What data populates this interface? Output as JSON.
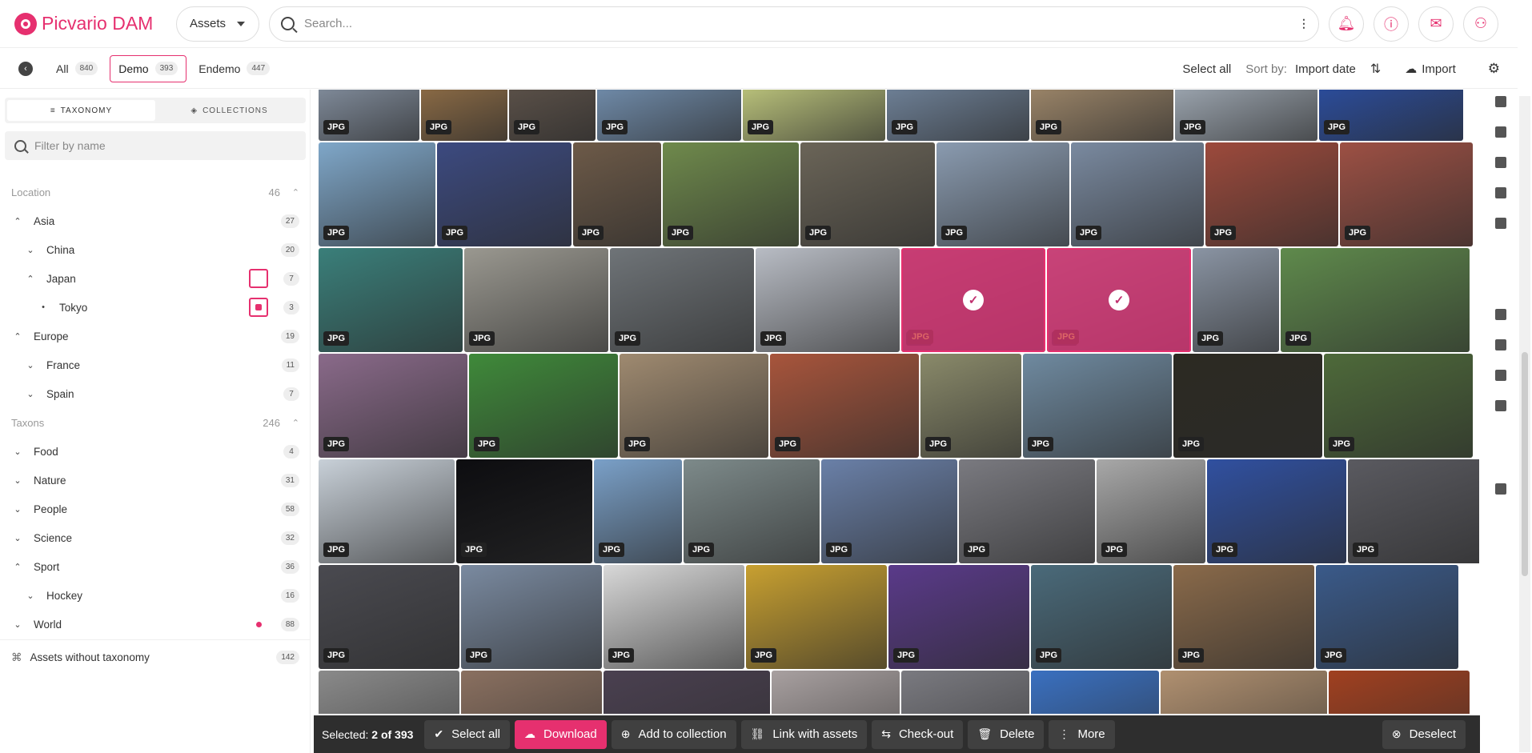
{
  "app": {
    "brand_prefix": "Picvario",
    "brand_suffix": "DAM"
  },
  "header": {
    "scope_dropdown": "Assets",
    "search_placeholder": "Search...",
    "icons": [
      "sliders-icon",
      "bell-icon",
      "info-icon",
      "inbox-icon",
      "user-icon"
    ]
  },
  "subbar": {
    "tabs": [
      {
        "label": "All",
        "count": "840"
      },
      {
        "label": "Demo",
        "count": "393"
      },
      {
        "label": "Endemo",
        "count": "447"
      }
    ],
    "select_all": "Select all",
    "sort_label": "Sort by:",
    "sort_value": "Import date",
    "import": "Import"
  },
  "sidebar": {
    "switch": {
      "taxonomy": "TAXONOMY",
      "collections": "COLLECTIONS"
    },
    "filter_placeholder": "Filter by name",
    "tree": [
      {
        "label": "Location",
        "count": "46",
        "section": true
      },
      {
        "label": "Asia",
        "count": "27",
        "chev": "up",
        "level": 0
      },
      {
        "label": "China",
        "count": "20",
        "chev": "down",
        "level": 1
      },
      {
        "label": "Japan",
        "count": "7",
        "chev": "up",
        "level": 1,
        "checkbox": "empty"
      },
      {
        "label": "Tokyo",
        "count": "3",
        "chev": "bullet",
        "level": 2,
        "checkbox": "partial"
      },
      {
        "label": "Europe",
        "count": "19",
        "chev": "up",
        "level": 0
      },
      {
        "label": "France",
        "count": "11",
        "chev": "down",
        "level": 1
      },
      {
        "label": "Spain",
        "count": "7",
        "chev": "down",
        "level": 1
      },
      {
        "label": "Taxons",
        "count": "246",
        "section": true
      },
      {
        "label": "Food",
        "count": "4",
        "chev": "down",
        "level": 0
      },
      {
        "label": "Nature",
        "count": "31",
        "chev": "down",
        "level": 0
      },
      {
        "label": "People",
        "count": "58",
        "chev": "down",
        "level": 0
      },
      {
        "label": "Science",
        "count": "32",
        "chev": "down",
        "level": 0
      },
      {
        "label": "Sport",
        "count": "36",
        "chev": "up",
        "level": 0
      },
      {
        "label": "Hockey",
        "count": "16",
        "chev": "down",
        "level": 1
      },
      {
        "label": "World",
        "count": "88",
        "chev": "down",
        "level": 0,
        "dot": true
      }
    ],
    "without_taxonomy": {
      "label": "Assets without taxonomy",
      "count": "142"
    }
  },
  "grid": {
    "badge": "JPG",
    "rows": [
      {
        "widths": [
          126,
          108,
          108,
          180,
          178,
          178,
          178,
          178,
          180
        ],
        "colors": [
          "#7f8a99",
          "#8a6a45",
          "#5a5048",
          "#6f8aa8",
          "#b8c07a",
          "#6d7f95",
          "#9a8468",
          "#9aa3ad",
          "#2b4c9a"
        ]
      },
      {
        "widths": [
          146,
          168,
          110,
          170,
          168,
          166,
          166,
          166,
          166
        ],
        "colors": [
          "#7fa7c9",
          "#3c4a80",
          "#6d5a48",
          "#6f8a4c",
          "#6b6558",
          "#8a9bb0",
          "#7a8aa0",
          "#9d4a3c",
          "#9d5044"
        ]
      },
      {
        "widths": [
          180,
          180,
          180,
          180,
          180,
          180,
          108,
          236
        ],
        "colors": [
          "#3a7f7a",
          "#9a9890",
          "#6f7478",
          "#b8bcc4",
          "#c47a90",
          "#c8a2b0",
          "#8a94a3",
          "#5f8a4c"
        ],
        "selected": [
          4,
          5
        ]
      },
      {
        "widths": [
          186,
          186,
          186,
          186,
          126,
          186,
          186,
          186
        ],
        "colors": [
          "#8a6a8a",
          "#3f8a3a",
          "#9f8a70",
          "#a8553c",
          "#8a8a6a",
          "#6f8aa0",
          "#2c2a22",
          "#4e6a3a"
        ]
      },
      {
        "widths": [
          170,
          170,
          110,
          170,
          170,
          170,
          136,
          174,
          170
        ],
        "colors": [
          "#c8d0d8",
          "#0d0d10",
          "#7aa0c8",
          "#7d8a8a",
          "#6a80a8",
          "#7a7a80",
          "#a8a8a8",
          "#3050a0",
          "#5a5a60"
        ]
      },
      {
        "widths": [
          176,
          176,
          176,
          176,
          176,
          176,
          176,
          178
        ],
        "colors": [
          "#4a4a50",
          "#7a8aa0",
          "#d8d8d8",
          "#c8a030",
          "#5a3a8a",
          "#4a6a7a",
          "#8a6a4a",
          "#3a5a8a"
        ]
      },
      {
        "widths": [
          176,
          176,
          208,
          160,
          160,
          160,
          208,
          176
        ],
        "colors": [
          "#8a8a8a",
          "#8a7060",
          "#4a4050",
          "#a8a0a0",
          "#7a7a80",
          "#3a70c0",
          "#b09070",
          "#a04020"
        ]
      }
    ]
  },
  "actionbar": {
    "selected_prefix": "Selected:",
    "selected_value": "2 of 393",
    "select_all": "Select all",
    "download": "Download",
    "add_to_collection": "Add to collection",
    "link_with_assets": "Link with assets",
    "check_out": "Check-out",
    "delete": "Delete",
    "more": "More",
    "deselect": "Deselect"
  },
  "colors": {
    "accent": "#e6306f"
  }
}
